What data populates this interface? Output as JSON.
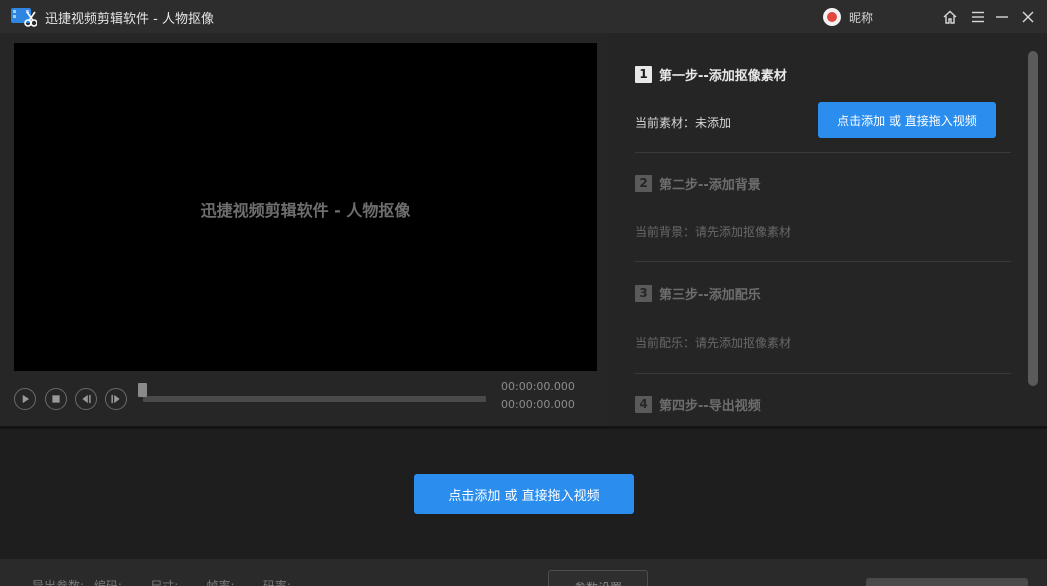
{
  "window": {
    "title": "迅捷视频剪辑软件 - 人物抠像",
    "user_nick": "昵称"
  },
  "icons": {
    "logo": "scissors-film-icon",
    "avatar": "avatar-icon",
    "home": "home-icon",
    "menu": "menu-icon",
    "minimize": "minimize-icon",
    "close": "close-icon",
    "play": "play-icon",
    "stop": "stop-icon",
    "prev_frame": "prev-frame-icon",
    "next_frame": "next-frame-icon"
  },
  "colors": {
    "accent": "#2b8eef",
    "background": "#1e1e1e",
    "panel": "#252525",
    "titlebar": "#2d2d2d"
  },
  "preview": {
    "label": "迅捷视频剪辑软件 - 人物抠像",
    "current_time": "00:00:00.000",
    "total_time": "00:00:00.000",
    "progress": 0
  },
  "steps": [
    {
      "number": "1",
      "title": "第一步--添加抠像素材",
      "current": "当前素材：未添加",
      "button": "点击添加 或 直接拖入视频"
    },
    {
      "number": "2",
      "title": "第二步--添加背景",
      "current": "当前背景：请先添加抠像素材"
    },
    {
      "number": "3",
      "title": "第三步--添加配乐",
      "current": "当前配乐：请先添加抠像素材"
    },
    {
      "number": "4",
      "title": "第四步--导出视频"
    }
  ],
  "main_button": "点击添加 或 直接拖入视频",
  "footer": {
    "export_params": "导出参数: 编码: -- 尺寸: -- 帧率: -- 码率: --",
    "settings_button": "参数设置"
  }
}
